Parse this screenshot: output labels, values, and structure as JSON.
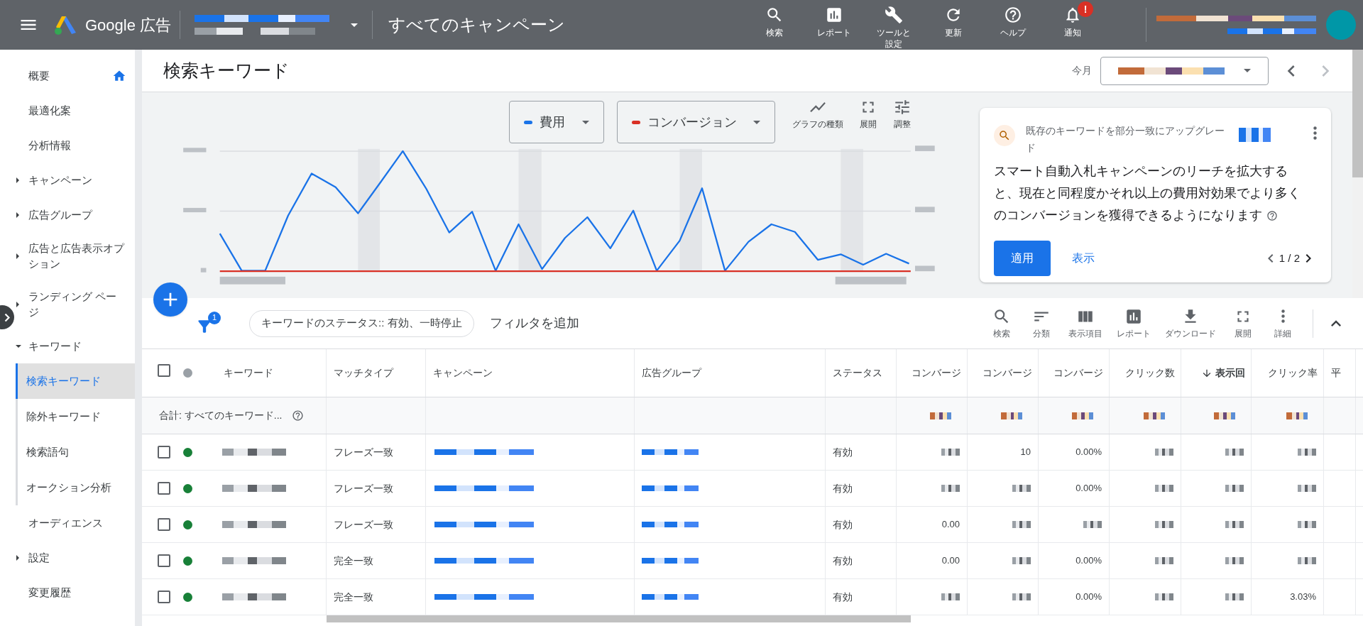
{
  "top_bar": {
    "product": "Google 広告",
    "view": "すべてのキャンペーン",
    "actions": [
      {
        "label": "検索"
      },
      {
        "label": "レポート"
      },
      {
        "label": "ツールと設定"
      },
      {
        "label": "更新"
      },
      {
        "label": "ヘルプ"
      },
      {
        "label": "通知",
        "badge": "!"
      }
    ]
  },
  "sidebar": {
    "items": [
      {
        "label": "概要",
        "kind": "home",
        "selected": false
      },
      {
        "label": "最適化案",
        "kind": "plain",
        "selected": false
      },
      {
        "label": "分析情報",
        "kind": "plain",
        "selected": false
      },
      {
        "label": "キャンペーン",
        "kind": "group",
        "expanded": false,
        "selected": false
      },
      {
        "label": "広告グループ",
        "kind": "group",
        "expanded": false,
        "selected": false
      },
      {
        "label": "広告と広告表示オプション",
        "kind": "group",
        "expanded": false,
        "selected": false
      },
      {
        "label": "ランディング ページ",
        "kind": "group",
        "expanded": false,
        "selected": false
      },
      {
        "label": "キーワード",
        "kind": "group",
        "expanded": true,
        "selected": false,
        "children": [
          {
            "label": "検索キーワード",
            "selected": true
          },
          {
            "label": "除外キーワード",
            "selected": false
          },
          {
            "label": "検索語句",
            "selected": false
          },
          {
            "label": "オークション分析",
            "selected": false
          }
        ]
      },
      {
        "label": "オーディエンス",
        "kind": "plain",
        "selected": false
      },
      {
        "label": "設定",
        "kind": "group",
        "expanded": false,
        "selected": false
      },
      {
        "label": "変更履歴",
        "kind": "plain",
        "selected": false
      }
    ]
  },
  "page_header": {
    "title": "検索キーワード",
    "date_range": {
      "label": "今月",
      "next_disabled": true
    }
  },
  "chart": {
    "series": [
      {
        "label": "費用",
        "color": "#1a73e8"
      },
      {
        "label": "コンバージョン",
        "color": "#d93025"
      }
    ],
    "tools": [
      {
        "label": "グラフの種類"
      },
      {
        "label": "展開"
      },
      {
        "label": "調整"
      }
    ]
  },
  "recommendation": {
    "title": "既存のキーワードを部分一致にアップグレード",
    "body": "スマート自動入札キャンペーンのリーチを拡大すると、現在と同程度かそれ以上の費用対効果でより多くのコンバージョンを獲得できるようになります",
    "apply": "適用",
    "view": "表示",
    "pager": "1 / 2"
  },
  "table_toolbar": {
    "filter_count": "1",
    "filter_chip": "キーワードのステータス:: 有効、一時停止",
    "add_filter": "フィルタを追加",
    "tools": [
      {
        "label": "検索"
      },
      {
        "label": "分類"
      },
      {
        "label": "表示項目"
      },
      {
        "label": "レポート"
      },
      {
        "label": "ダウンロード"
      },
      {
        "label": "展開"
      },
      {
        "label": "詳細"
      }
    ]
  },
  "table": {
    "select_all": {
      "checked": false
    },
    "columns": [
      {
        "label": "キーワード",
        "sorted": false
      },
      {
        "label": "マッチタイプ",
        "sorted": false
      },
      {
        "label": "キャンペーン",
        "sorted": false
      },
      {
        "label": "広告グループ",
        "sorted": false
      },
      {
        "label": "ステータス",
        "sorted": false
      },
      {
        "label": "コンバージ",
        "sorted": false
      },
      {
        "label": "コンバージ",
        "sorted": false
      },
      {
        "label": "コンバージ",
        "sorted": false
      },
      {
        "label": "クリック数",
        "sorted": false
      },
      {
        "label": "表示回",
        "sorted": true
      },
      {
        "label": "クリック率",
        "sorted": false
      },
      {
        "label": "平",
        "sorted": false
      }
    ],
    "total": {
      "label": "合計: すべてのキーワード..."
    },
    "rows": [
      {
        "checked": false,
        "color": "#188038",
        "match_type": "フレーズ一致",
        "status": "有効",
        "metrics": [
          {
            "kind": "blurred"
          },
          {
            "kind": "text",
            "text": "10"
          },
          {
            "kind": "text",
            "text": "0.00%"
          },
          {
            "kind": "blurred"
          },
          {
            "kind": "blurred"
          },
          {
            "kind": "blurred"
          }
        ]
      },
      {
        "checked": false,
        "color": "#188038",
        "match_type": "フレーズ一致",
        "status": "有効",
        "metrics": [
          {
            "kind": "blurred"
          },
          {
            "kind": "blurred"
          },
          {
            "kind": "text",
            "text": "0.00%"
          },
          {
            "kind": "blurred"
          },
          {
            "kind": "blurred"
          },
          {
            "kind": "blurred"
          }
        ]
      },
      {
        "checked": false,
        "color": "#188038",
        "match_type": "フレーズ一致",
        "status": "有効",
        "metrics": [
          {
            "kind": "text",
            "text": "0.00"
          },
          {
            "kind": "blurred"
          },
          {
            "kind": "blurred"
          },
          {
            "kind": "blurred"
          },
          {
            "kind": "blurred"
          },
          {
            "kind": "blurred"
          }
        ]
      },
      {
        "checked": false,
        "color": "#188038",
        "match_type": "完全一致",
        "status": "有効",
        "metrics": [
          {
            "kind": "text",
            "text": "0.00"
          },
          {
            "kind": "blurred"
          },
          {
            "kind": "text",
            "text": "0.00%"
          },
          {
            "kind": "blurred"
          },
          {
            "kind": "blurred"
          },
          {
            "kind": "blurred"
          }
        ]
      },
      {
        "checked": false,
        "color": "#188038",
        "match_type": "完全一致",
        "status": "有効",
        "metrics": [
          {
            "kind": "blurred"
          },
          {
            "kind": "blurred"
          },
          {
            "kind": "text",
            "text": "0.00%"
          },
          {
            "kind": "blurred"
          },
          {
            "kind": "blurred"
          },
          {
            "kind": "text",
            "text": "3.03%"
          }
        ]
      }
    ]
  }
}
